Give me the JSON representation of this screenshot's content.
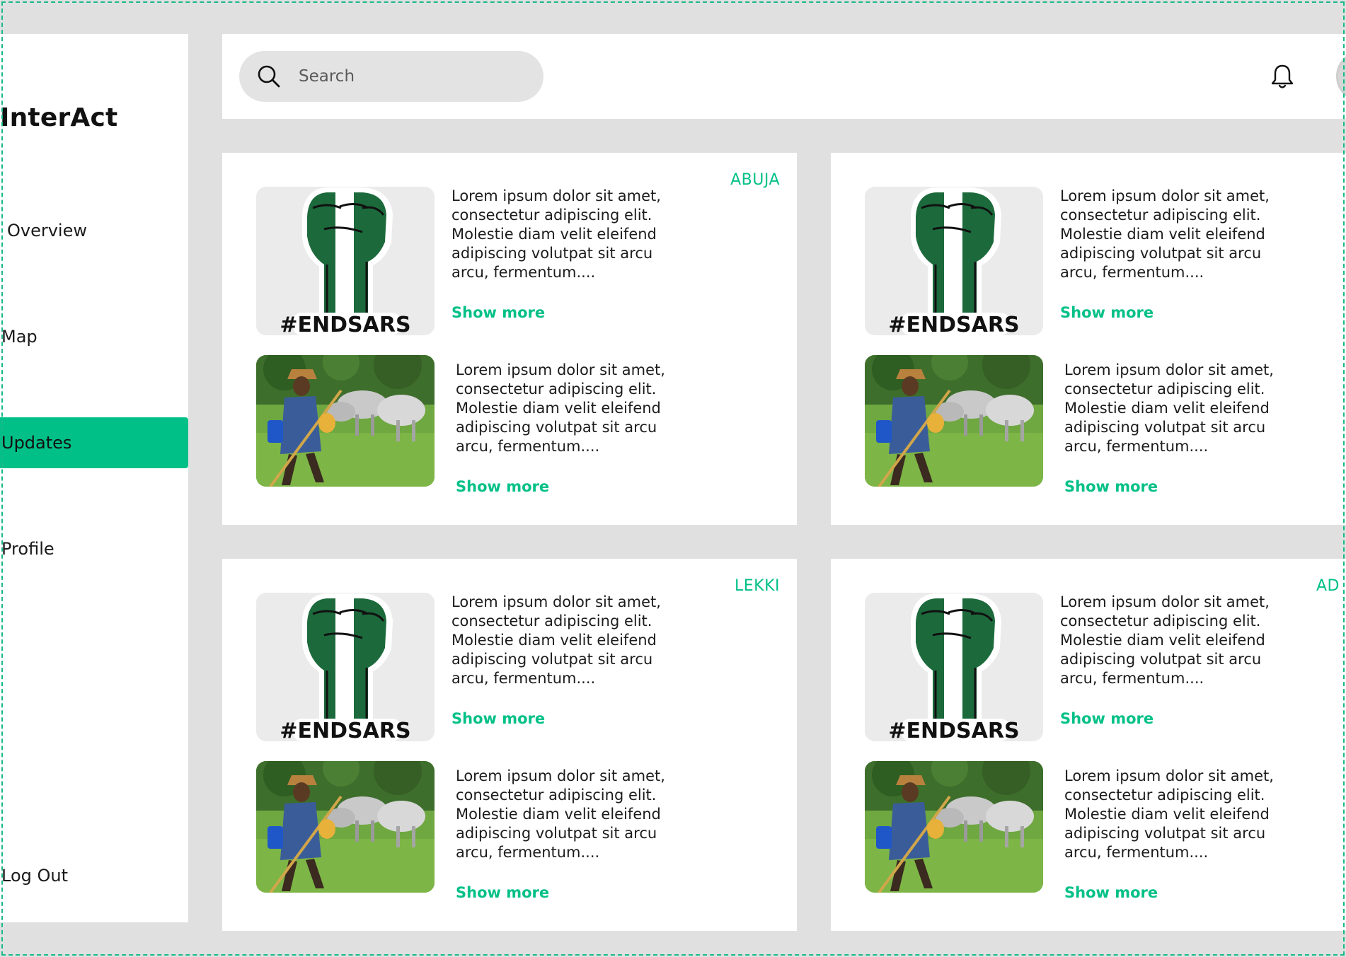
{
  "app": {
    "logo": "InterAct"
  },
  "sidebar": {
    "items": [
      {
        "label": "Overview",
        "active": false
      },
      {
        "label": "Map",
        "active": false
      },
      {
        "label": "Updates",
        "active": true
      },
      {
        "label": "Profile",
        "active": false
      }
    ],
    "logout_label": "Log Out"
  },
  "header": {
    "search": {
      "placeholder": "Search",
      "icon": "search-icon"
    },
    "notification_icon": "bell-icon"
  },
  "accent_color": "#00c087",
  "cards": [
    {
      "location": "ABUJA",
      "posts": [
        {
          "image": "endsars-fist",
          "image_text": "#ENDSARS",
          "text": "Lorem ipsum dolor sit amet, consectetur adipiscing elit. Molestie diam velit eleifend adipiscing volutpat sit arcu arcu, fermentum....",
          "show_more": "Show more"
        },
        {
          "image": "herder-cattle",
          "text": "Lorem ipsum dolor sit amet, consectetur adipiscing elit. Molestie diam velit eleifend adipiscing volutpat sit arcu arcu, fermentum....",
          "show_more": "Show more"
        }
      ]
    },
    {
      "location": "",
      "posts": [
        {
          "image": "endsars-fist",
          "image_text": "#ENDSARS",
          "text": "Lorem ipsum dolor sit amet, consectetur adipiscing elit. Molestie diam velit eleifend adipiscing volutpat sit arcu arcu, fermentum....",
          "show_more": "Show more"
        },
        {
          "image": "herder-cattle",
          "text": "Lorem ipsum dolor sit amet, consectetur adipiscing elit. Molestie diam velit eleifend adipiscing volutpat sit arcu arcu, fermentum....",
          "show_more": "Show more"
        }
      ]
    },
    {
      "location": "LEKKI",
      "posts": [
        {
          "image": "endsars-fist",
          "image_text": "#ENDSARS",
          "text": "Lorem ipsum dolor sit amet, consectetur adipiscing elit. Molestie diam velit eleifend adipiscing volutpat sit arcu arcu, fermentum....",
          "show_more": "Show more"
        },
        {
          "image": "herder-cattle",
          "text": "Lorem ipsum dolor sit amet, consectetur adipiscing elit. Molestie diam velit eleifend adipiscing volutpat sit arcu arcu, fermentum....",
          "show_more": "Show more"
        }
      ]
    },
    {
      "location": "AD",
      "posts": [
        {
          "image": "endsars-fist",
          "image_text": "#ENDSARS",
          "text": "Lorem ipsum dolor sit amet, consectetur adipiscing elit. Molestie diam velit eleifend adipiscing volutpat sit arcu arcu, fermentum....",
          "show_more": "Show more"
        },
        {
          "image": "herder-cattle",
          "text": "Lorem ipsum dolor sit amet, consectetur adipiscing elit. Molestie diam velit eleifend adipiscing volutpat sit arcu arcu, fermentum....",
          "show_more": "Show more"
        }
      ]
    }
  ]
}
